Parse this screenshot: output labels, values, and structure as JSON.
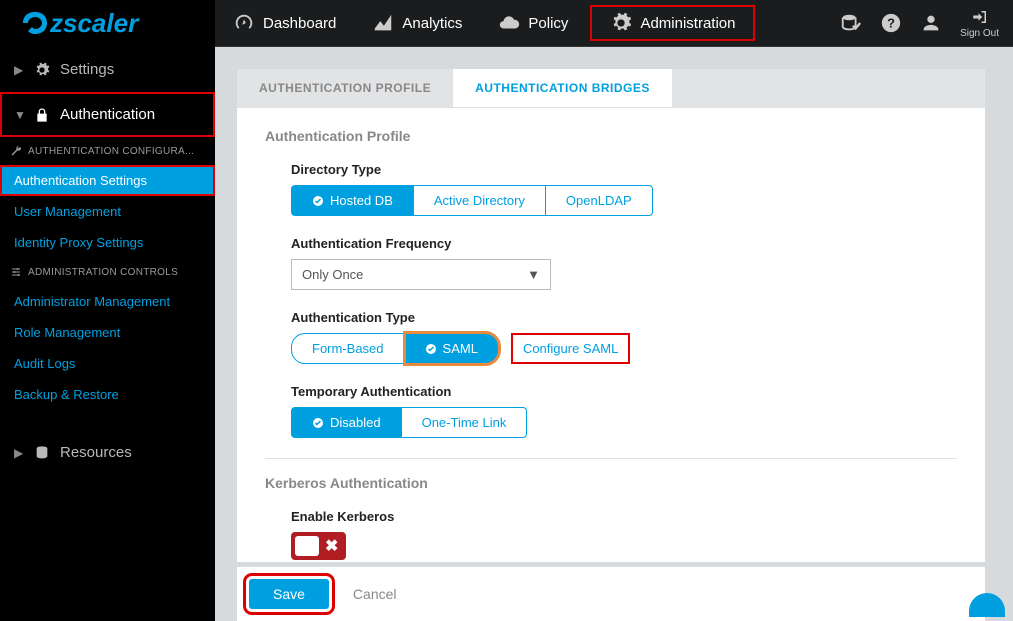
{
  "brand": "zscaler",
  "nav": {
    "items": [
      {
        "icon": "gauge",
        "label": "Dashboard"
      },
      {
        "icon": "chart",
        "label": "Analytics"
      },
      {
        "icon": "cloud",
        "label": "Policy"
      },
      {
        "icon": "gears",
        "label": "Administration"
      }
    ],
    "signout": "Sign Out"
  },
  "sidebar": {
    "sections": [
      {
        "icon": "gear",
        "label": "Settings"
      },
      {
        "icon": "lock",
        "label": "Authentication"
      }
    ],
    "auth_header": "AUTHENTICATION CONFIGURA...",
    "auth_links": [
      "Authentication Settings",
      "User Management",
      "Identity Proxy Settings"
    ],
    "admin_header": "ADMINISTRATION CONTROLS",
    "admin_links": [
      "Administrator Management",
      "Role Management",
      "Audit Logs",
      "Backup & Restore"
    ],
    "resources": "Resources"
  },
  "tabs": [
    "AUTHENTICATION PROFILE",
    "AUTHENTICATION BRIDGES"
  ],
  "profile": {
    "title": "Authentication Profile",
    "dir_label": "Directory Type",
    "dir_opts": [
      "Hosted DB",
      "Active Directory",
      "OpenLDAP"
    ],
    "freq_label": "Authentication Frequency",
    "freq_value": "Only Once",
    "type_label": "Authentication Type",
    "type_opts": [
      "Form-Based",
      "SAML"
    ],
    "configure_saml": "Configure SAML",
    "temp_label": "Temporary Authentication",
    "temp_opts": [
      "Disabled",
      "One-Time Link"
    ],
    "kerb_title": "Kerberos Authentication",
    "kerb_label": "Enable Kerberos"
  },
  "footer": {
    "save": "Save",
    "cancel": "Cancel"
  }
}
